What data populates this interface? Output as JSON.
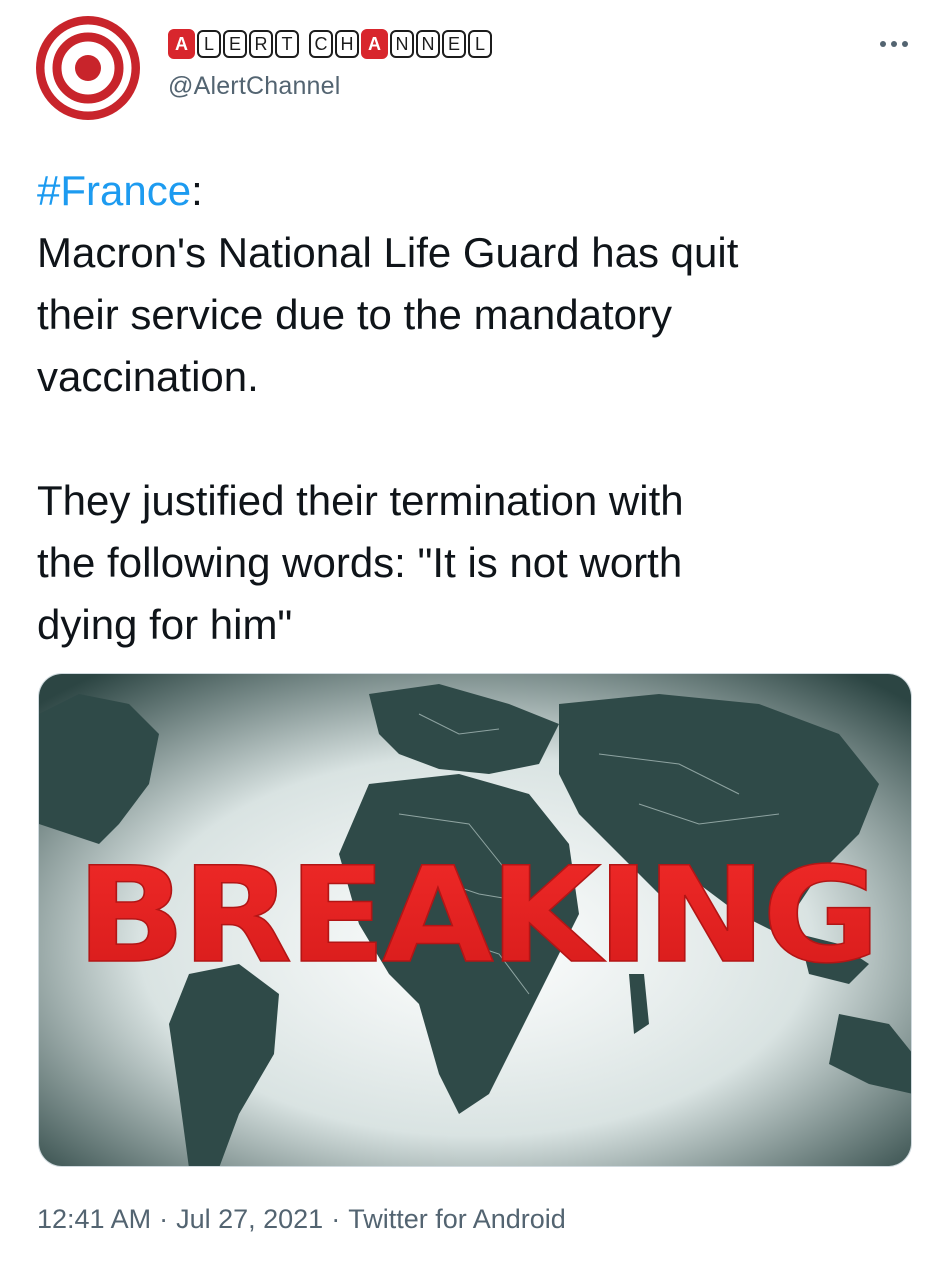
{
  "author": {
    "display_name_tiles": [
      {
        "ch": "A",
        "style": "red"
      },
      {
        "ch": "L",
        "style": "outline"
      },
      {
        "ch": "E",
        "style": "outline"
      },
      {
        "ch": "R",
        "style": "outline"
      },
      {
        "ch": "T",
        "style": "outline"
      },
      {
        "ch": " ",
        "style": "gap"
      },
      {
        "ch": "C",
        "style": "outline"
      },
      {
        "ch": "H",
        "style": "outline"
      },
      {
        "ch": "A",
        "style": "red"
      },
      {
        "ch": "N",
        "style": "outline"
      },
      {
        "ch": "N",
        "style": "outline"
      },
      {
        "ch": "E",
        "style": "outline"
      },
      {
        "ch": "L",
        "style": "outline"
      }
    ],
    "handle": "@AlertChannel",
    "avatar_icon": "target-icon"
  },
  "menu": {
    "icon": "more-dots-icon"
  },
  "tweet": {
    "hashtag": "#France",
    "hashtag_suffix": ":",
    "lines_1": [
      "Macron's National Life Guard has quit",
      "their service due to the mandatory",
      "vaccination."
    ],
    "lines_2": [
      "They justified their termination with",
      "the following words: \"It is not worth",
      "dying for him\""
    ]
  },
  "media": {
    "overlay_text": "BREAKING",
    "description_icon": "world-map-image"
  },
  "meta": {
    "time": "12:41 AM",
    "date": "Jul 27, 2021",
    "separator": "·",
    "source": "Twitter for Android"
  },
  "colors": {
    "link": "#1d9bf0",
    "text": "#0f1419",
    "secondary": "#536471",
    "brand_red": "#d8262d",
    "breaking_red": "#e8201f",
    "map_land": "#2f4a48"
  }
}
